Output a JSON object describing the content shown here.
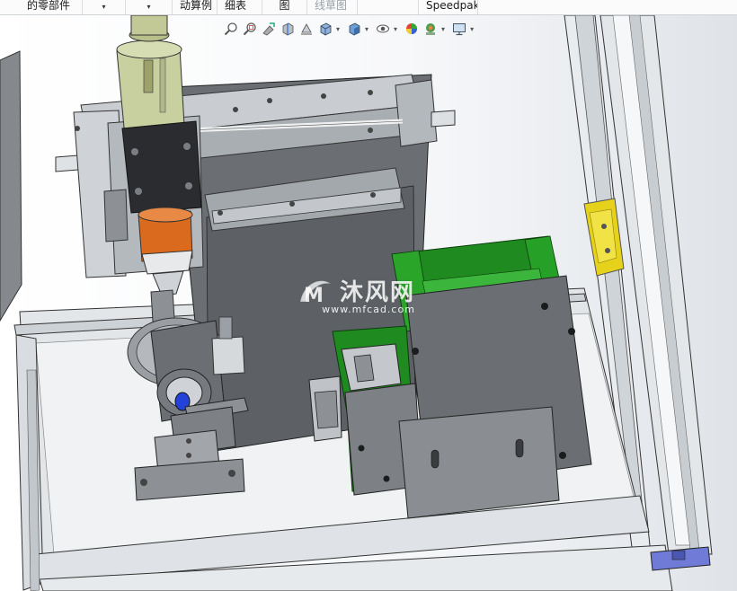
{
  "ribbon": {
    "tabs": [
      {
        "label": "的零部件",
        "disabled": false,
        "has_dropdown": false
      },
      {
        "label": "",
        "disabled": false,
        "has_dropdown": true
      },
      {
        "label": "",
        "disabled": false,
        "has_dropdown": true
      },
      {
        "label": "动算例",
        "disabled": false,
        "has_dropdown": false
      },
      {
        "label": "细表",
        "disabled": false,
        "has_dropdown": false
      },
      {
        "label": "图",
        "disabled": false,
        "has_dropdown": false
      },
      {
        "label": "线草图",
        "disabled": true,
        "has_dropdown": false
      },
      {
        "label": "",
        "disabled": false,
        "has_dropdown": false
      },
      {
        "label": "Speedpak",
        "disabled": false,
        "has_dropdown": false
      }
    ],
    "dropdown_glyph": "▾"
  },
  "heads_up_toolbar": {
    "items": [
      {
        "name": "zoom-to-fit-icon",
        "dropdown": false
      },
      {
        "name": "zoom-to-area-icon",
        "dropdown": false
      },
      {
        "name": "previous-view-icon",
        "dropdown": false
      },
      {
        "name": "section-view-icon",
        "dropdown": false
      },
      {
        "name": "dynamic-annotation-icon",
        "dropdown": false
      },
      {
        "name": "view-orientation-icon",
        "dropdown": true
      },
      {
        "name": "display-style-icon",
        "dropdown": true
      },
      {
        "name": "hide-show-items-icon",
        "dropdown": true
      },
      {
        "name": "edit-appearance-icon",
        "dropdown": false
      },
      {
        "name": "apply-scene-icon",
        "dropdown": true
      },
      {
        "name": "view-settings-icon",
        "dropdown": true
      }
    ],
    "dropdown_glyph": "▾"
  },
  "watermark": {
    "logo_letter": "M",
    "text": "沐风网",
    "url": "www.mfcad.com"
  },
  "colors": {
    "frame_aluminum": "#d9dde0",
    "plate_gray": "#6b6f74",
    "green_housing": "#1f8a1f",
    "orange_sleeve": "#d96a1e",
    "yellow_bracket": "#e6d21a",
    "purple_end_cap": "#6f7bd6",
    "blue_part": "#2343d8"
  }
}
